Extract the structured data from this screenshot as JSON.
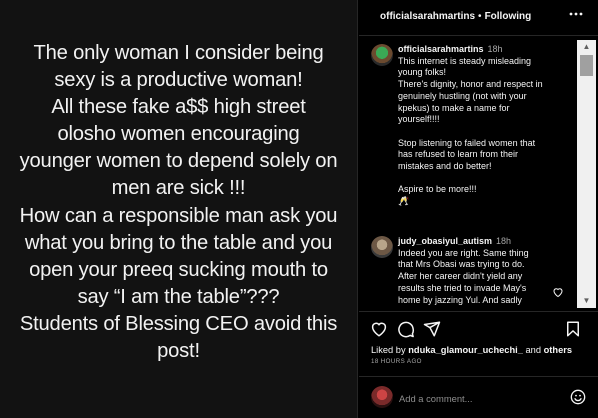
{
  "post": {
    "text": "The only woman I consider being\nsexy is a productive woman!\nAll these fake a$$ high street\nolosho women encouraging\nyounger women to depend solely on\nmen are sick !!!\nHow can a responsible man ask you\nwhat you bring to the table and you\nopen your preeq sucking mouth to\nsay “I am the table”???\nStudents of Blessing CEO avoid this\npost!"
  },
  "header": {
    "username": "officialsarahmartins",
    "separator": "•",
    "following": "Following",
    "more_icon": "more-dots-icon"
  },
  "comments": [
    {
      "username": "officialsarahmartins",
      "time": "18h",
      "text": "This internet is steady misleading\nyoung folks!\nThere's dignity, honor and respect in\ngenuinely hustling (not with your\nkpekus) to make a name for\nyourself!!!!\n\nStop listening to failed women that\nhas refused to learn from their\nmistakes and do better!\n\nAspire to be more!!!\n🥂"
    },
    {
      "username": "judy_obasiyul_autism",
      "time": "18h",
      "text": "Indeed you are right. Same thing\nthat Mrs Obasi was trying to do.\nAfter her career didn't yield any\nresults she tried to invade May's\nhome by jazzing Yul. And sadly"
    }
  ],
  "actions": {
    "icons": [
      "heart-icon",
      "comment-icon",
      "share-icon",
      "save-icon"
    ]
  },
  "likes": {
    "prefix": "Liked by ",
    "user": "nduka_glamour_uchechi_",
    "suffix": " and ",
    "others": "others"
  },
  "timestamp": "18 HOURS AGO",
  "add_comment": {
    "placeholder": "Add a comment..."
  },
  "colors": {
    "background": "#000000",
    "post_background": "#121212",
    "divider": "#262626",
    "secondary_text": "#a8a8a8"
  }
}
